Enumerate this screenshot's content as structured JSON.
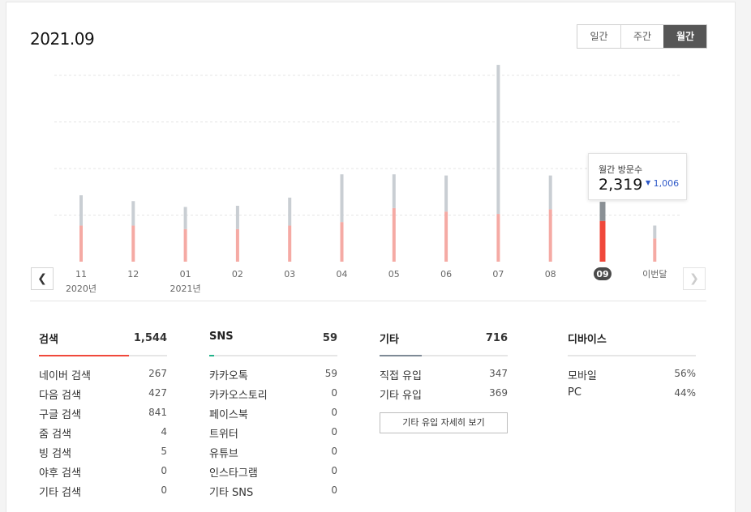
{
  "header": {
    "title": "2021.09"
  },
  "period_tabs": [
    {
      "label": "일간",
      "active": false
    },
    {
      "label": "주간",
      "active": false
    },
    {
      "label": "월간",
      "active": true
    }
  ],
  "colors": {
    "bar_gray": "#c9ced3",
    "bar_pink": "#f5aaa4",
    "bar_red": "#f0483b",
    "bar_selected_gray": "#8a9095",
    "selected_badge": "#4a4a4a",
    "search": "#f0483b",
    "sns": "#22b38a",
    "etc": "#7e8a96",
    "diff_blue": "#2e59c8"
  },
  "chart_data": {
    "type": "bar",
    "stacked": true,
    "categories": [
      "11",
      "12",
      "01",
      "02",
      "03",
      "04",
      "05",
      "06",
      "07",
      "08",
      "09",
      "이번달"
    ],
    "year_labels": [
      "2020년",
      "",
      "2021년",
      "",
      "",
      "",
      "",
      "",
      "",
      "",
      "",
      ""
    ],
    "series": [
      {
        "values": [
          1550,
          1550,
          1400,
          1400,
          1550,
          1700,
          2300,
          2150,
          2050,
          2250,
          1750,
          1000
        ]
      },
      {
        "values": [
          1300,
          1050,
          950,
          1000,
          1200,
          2050,
          1450,
          1550,
          6400,
          1450,
          819,
          550
        ]
      }
    ],
    "selected_index": 10,
    "y_max": 8000,
    "grid": true
  },
  "tooltip": {
    "label": "월간 방문수",
    "value": "2,319",
    "diff": "1,006",
    "diff_direction": "down"
  },
  "nav": {
    "prev_icon": "chevron-left-icon",
    "next_icon": "chevron-right-icon"
  },
  "stats": {
    "search": {
      "title": "검색",
      "total": "1,544",
      "ratio": 0.7,
      "items": [
        {
          "label": "네이버 검색",
          "value": "267"
        },
        {
          "label": "다음 검색",
          "value": "427"
        },
        {
          "label": "구글 검색",
          "value": "841"
        },
        {
          "label": "줌 검색",
          "value": "4"
        },
        {
          "label": "빙 검색",
          "value": "5"
        },
        {
          "label": "야후 검색",
          "value": "0"
        },
        {
          "label": "기타 검색",
          "value": "0"
        }
      ]
    },
    "sns": {
      "title": "SNS",
      "total": "59",
      "ratio": 0.04,
      "items": [
        {
          "label": "카카오톡",
          "value": "59"
        },
        {
          "label": "카카오스토리",
          "value": "0"
        },
        {
          "label": "페이스북",
          "value": "0"
        },
        {
          "label": "트위터",
          "value": "0"
        },
        {
          "label": "유튜브",
          "value": "0"
        },
        {
          "label": "인스타그램",
          "value": "0"
        },
        {
          "label": "기타 SNS",
          "value": "0"
        }
      ]
    },
    "etc": {
      "title": "기타",
      "total": "716",
      "ratio": 0.33,
      "items": [
        {
          "label": "직접 유입",
          "value": "347"
        },
        {
          "label": "기타 유입",
          "value": "369"
        }
      ],
      "detail_button": "기타 유입 자세히 보기"
    },
    "device": {
      "title": "디바이스",
      "items": [
        {
          "label": "모바일",
          "value": "56%"
        },
        {
          "label": "PC",
          "value": "44%"
        }
      ]
    }
  }
}
